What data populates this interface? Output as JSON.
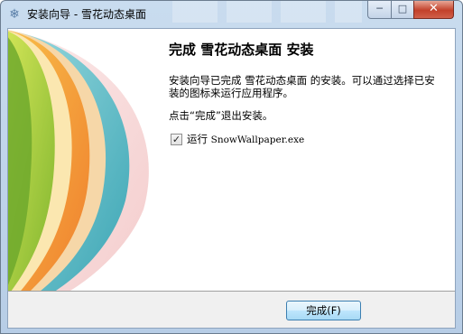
{
  "window": {
    "title": "安装向导 - 雪花动态桌面",
    "icon": "snowflake-icon"
  },
  "controls": {
    "minimize_symbol": "─",
    "maximize_symbol": "□",
    "close_symbol": "✕"
  },
  "page": {
    "heading": "完成 雪花动态桌面 安装",
    "finish_text": "安装向导已完成 雪花动态桌面 的安装。可以通过选择已安装的图标来运行应用程序。",
    "click_text": "点击“完成”退出安装。"
  },
  "run_option": {
    "checked": true,
    "check_mark": "✓",
    "label_prefix": "运行 ",
    "label_file": "SnowWallpaper.exe"
  },
  "buttons": {
    "finish_label": "完成(F)"
  },
  "colors": {
    "title_bar": "#c9dcef",
    "accent_button": "#bee6fd",
    "banner_green": "#9fc63a",
    "banner_orange": "#f39a3d",
    "banner_teal": "#58b8c4",
    "banner_pink": "#f4c8c8"
  }
}
